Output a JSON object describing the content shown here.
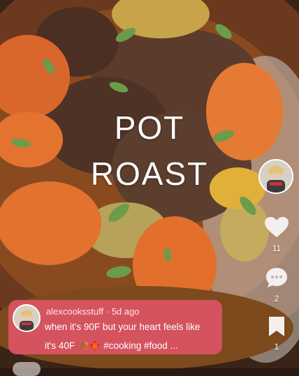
{
  "video": {
    "title_line1": "POT",
    "title_line2": "ROAST"
  },
  "actions": {
    "likes": "11",
    "comments": "2",
    "saves": "1"
  },
  "caption": {
    "username": "alexcooksstuff",
    "separator": " · ",
    "time_ago": "5d ago",
    "line1": "when it's 90F but your heart feels like",
    "line2": "it's 40F 🍂🍁 #cooking #food ..."
  },
  "colors": {
    "caption_bg": "#e8566e",
    "icon_white": "#ffffff"
  }
}
